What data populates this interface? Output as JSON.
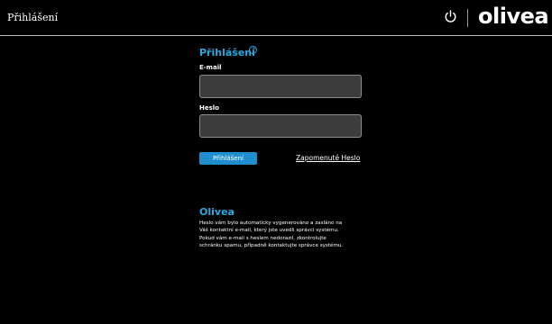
{
  "header": {
    "title": "Přihlášení",
    "logo_text": "olivea",
    "power_icon": "power-icon"
  },
  "login_form": {
    "title": "Přihlášení",
    "help_icon": "help-icon",
    "email_label": "E-mail",
    "email_value": "",
    "password_label": "Heslo",
    "password_value": "",
    "submit_label": "Přihlášení",
    "forgot_password_label": "Zapomenuté Heslo"
  },
  "info": {
    "title": "Olivea",
    "lines": [
      "Heslo vám bylo automaticky vygenerováno a zasláno na",
      "Váš kontaktní e-mail, který jste uvedli správci systému.",
      "Pokud vám e-mail s heslem nedorazil, zkontrolujte",
      "schránku spamu, případně kontaktujte správce systému."
    ]
  },
  "colors": {
    "background": "#000000",
    "accent": "#29a9df",
    "button": "#1f8fd0",
    "field": "#3c3c3c"
  }
}
